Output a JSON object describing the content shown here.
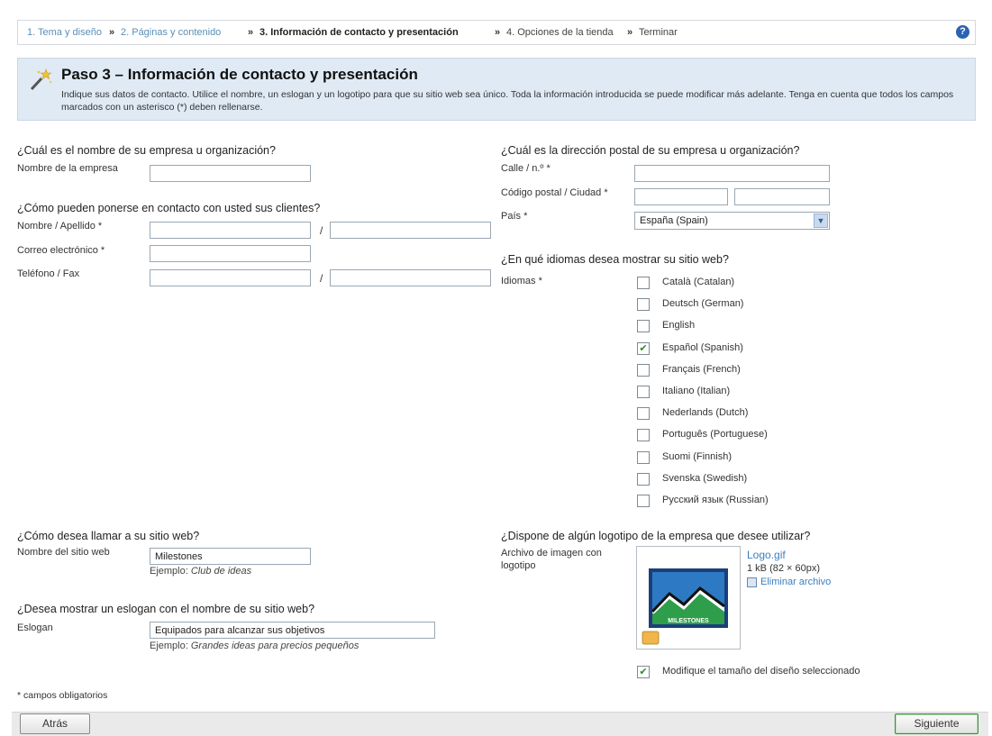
{
  "breadcrumb": {
    "step1": "1. Tema y diseño",
    "step2": "2. Páginas y contenido",
    "step3": "3. Información de contacto y presentación",
    "step4": "4. Opciones de la tienda",
    "step5": "Terminar",
    "separator": "»"
  },
  "header": {
    "title": "Paso 3 – Información de contacto y presentación",
    "description": "Indique sus datos de contacto. Utilice el nombre, un eslogan y un logotipo para que su sitio web sea único. Toda la información introducida se puede modificar más adelante. Tenga en cuenta que todos los campos marcados con un asterisco (*) deben rellenarse."
  },
  "company": {
    "question": "¿Cuál es el nombre de su empresa u organización?",
    "name_label": "Nombre de la empresa",
    "name_value": ""
  },
  "contact": {
    "question": "¿Cómo pueden ponerse en contacto con usted sus clientes?",
    "name_label": "Nombre / Apellido *",
    "email_label": "Correo electrónico *",
    "phone_label": "Teléfono / Fax",
    "slash": "/"
  },
  "address": {
    "question": "¿Cuál es la dirección postal de su empresa u organización?",
    "street_label": "Calle / n.º *",
    "postal_label": "Código postal / Ciudad *",
    "country_label": "País *",
    "country_value": "España (Spain)"
  },
  "languages": {
    "question": "¿En qué idiomas desea mostrar su sitio web?",
    "label": "Idiomas *",
    "items": [
      {
        "label": "Català (Catalan)",
        "checked": false
      },
      {
        "label": "Deutsch (German)",
        "checked": false
      },
      {
        "label": "English",
        "checked": false
      },
      {
        "label": "Español (Spanish)",
        "checked": true
      },
      {
        "label": "Français (French)",
        "checked": false
      },
      {
        "label": "Italiano (Italian)",
        "checked": false
      },
      {
        "label": "Nederlands (Dutch)",
        "checked": false
      },
      {
        "label": "Português (Portuguese)",
        "checked": false
      },
      {
        "label": "Suomi (Finnish)",
        "checked": false
      },
      {
        "label": "Svenska (Swedish)",
        "checked": false
      },
      {
        "label": "Русский язык (Russian)",
        "checked": false
      }
    ]
  },
  "website": {
    "question": "¿Cómo desea llamar a su sitio web?",
    "name_label": "Nombre del sitio web",
    "name_value": "Milestones",
    "example_prefix": "Ejemplo:",
    "example_value": "Club de ideas"
  },
  "slogan": {
    "question": "¿Desea mostrar un eslogan con el nombre de su sitio web?",
    "label": "Eslogan",
    "value": "Equipados para alcanzar sus objetivos",
    "example_prefix": "Ejemplo:",
    "example_value": "Grandes ideas para precios pequeños"
  },
  "logo": {
    "question": "¿Dispone de algún logotipo de la empresa que desee utilizar?",
    "label": "Archivo de imagen con logotipo",
    "file_name": "Logo.gif",
    "file_size": "1 kB (82 × 60px)",
    "delete_label": "Eliminar archivo",
    "logo_text": "MILESTONES",
    "resize_label": "Modifique el tamaño del diseño seleccionado",
    "resize_checked": true
  },
  "footer": {
    "required_note": "* campos obligatorios",
    "back_label": "Atrás",
    "next_label": "Siguiente"
  },
  "colors": {
    "header_bg": "#dfeaf5",
    "link": "#5a8fb6",
    "check": "#2b8a2b",
    "next_border": "#3d8c3d"
  }
}
